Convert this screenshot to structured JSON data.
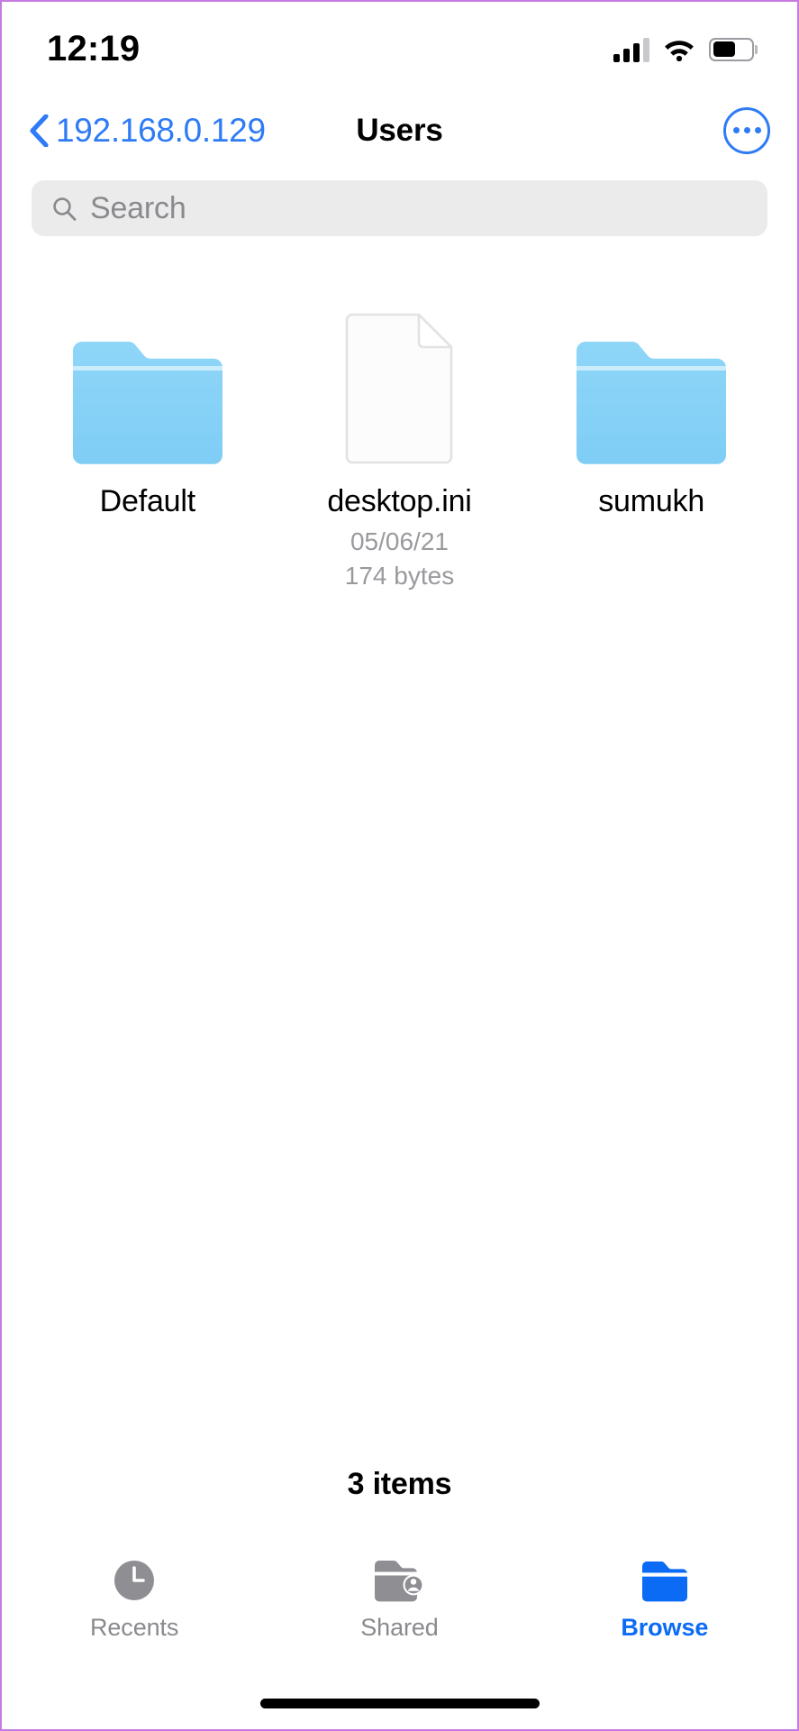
{
  "status_bar": {
    "time": "12:19",
    "signal_icon": "cellular-signal-icon",
    "signal_bars_total": 4,
    "signal_bars_filled": 3,
    "wifi_icon": "wifi-icon",
    "battery_icon": "battery-icon",
    "battery_level_percent": 60
  },
  "nav_bar": {
    "back_label": "192.168.0.129",
    "back_icon": "chevron-left-icon",
    "title": "Users",
    "more_icon": "ellipsis-circle-icon",
    "accent_color": "#2e7bf6"
  },
  "search": {
    "icon": "search-icon",
    "placeholder": "Search",
    "value": ""
  },
  "files": {
    "items": [
      {
        "name": "Default",
        "type": "folder",
        "icon": "folder-icon",
        "date": "",
        "size": ""
      },
      {
        "name": "desktop.ini",
        "type": "document",
        "icon": "document-icon",
        "date": "05/06/21",
        "size": "174 bytes"
      },
      {
        "name": "sumukh",
        "type": "folder",
        "icon": "folder-icon",
        "date": "",
        "size": ""
      }
    ],
    "count_label": "3 items"
  },
  "tab_bar": {
    "tabs": [
      {
        "label": "Recents",
        "icon": "clock-icon",
        "active": false
      },
      {
        "label": "Shared",
        "icon": "folder-person-icon",
        "active": false
      },
      {
        "label": "Browse",
        "icon": "folder-filled-icon",
        "active": true
      }
    ],
    "active_color": "#0b6bf5",
    "inactive_color": "#8a8a8e"
  },
  "home_indicator": "home-indicator"
}
